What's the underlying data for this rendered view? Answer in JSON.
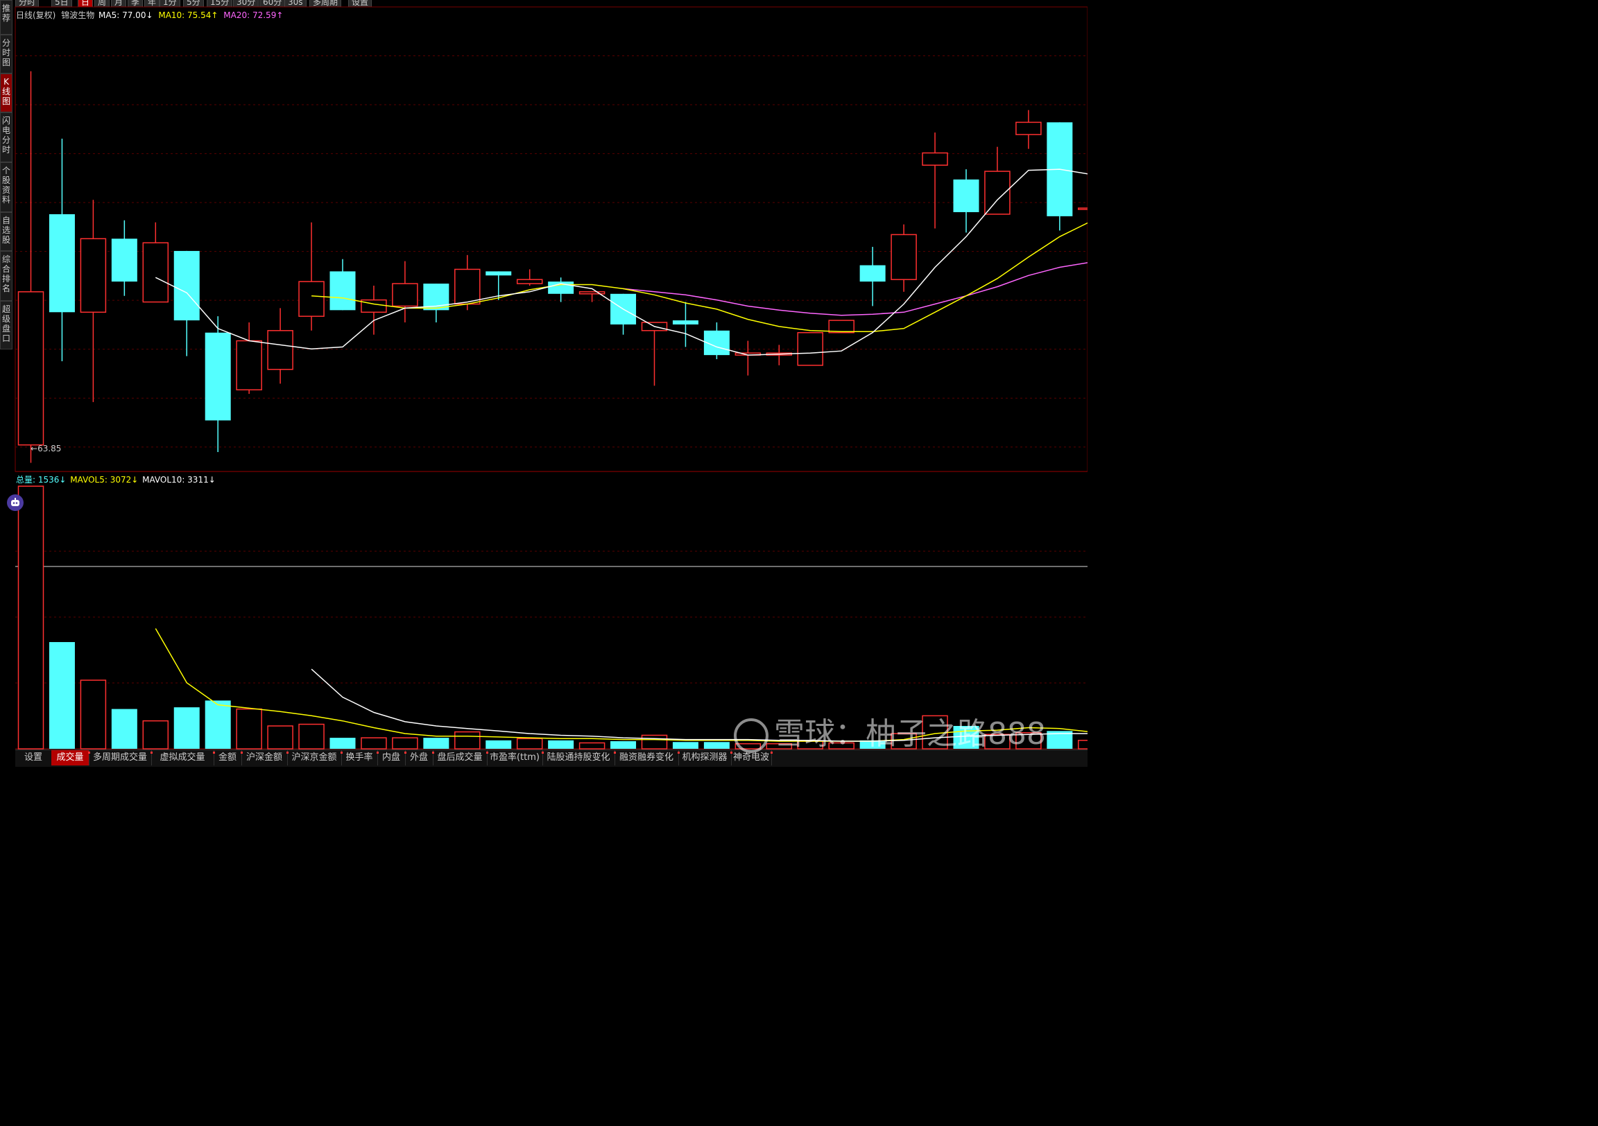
{
  "top_tabs": [
    "分时",
    "5日",
    "日",
    "周",
    "月",
    "季",
    "年",
    "1分",
    "5分",
    "15分",
    "30分",
    "60分",
    "30s",
    "多周期",
    "设置"
  ],
  "top_tabs_active": 2,
  "side_tabs": [
    "推荐",
    "分时图",
    "K线图",
    "闪电分时",
    "个股资料",
    "自选股",
    "综合排名",
    "超级盘口"
  ],
  "side_tabs_active": 2,
  "price_header": {
    "period": "日线(复权)",
    "name": "锦波生物",
    "ma5": "MA5: 77.00↓",
    "ma10": "MA10: 75.54↑",
    "ma20": "MA20: 72.59↑"
  },
  "low_label": "63.85",
  "volume_header": {
    "total": "总量: 1536↓",
    "mavol5": "MAVOL5: 3072↓",
    "mavol10": "MAVOL10: 3311↓"
  },
  "bottom_tabs": [
    "设置",
    "成交量",
    "多周期成交量",
    "虚拟成交量",
    "金额",
    "沪深金额",
    "沪深京金额",
    "换手率",
    "内盘",
    "外盘",
    "盘后成交量",
    "市盈率(ttm)",
    "陆股通持股变化",
    "融资融券变化",
    "机构探测器",
    "神奇电波"
  ],
  "bottom_tabs_active": 1,
  "watermark": "雪球：柚子之路888",
  "colors": {
    "up": "#ff3030",
    "down": "#54ffff",
    "ma5": "#ffffff",
    "ma10": "#ffff00",
    "ma20": "#ff66ff",
    "grid": "#5a0000"
  },
  "chart_data": {
    "type": "candlestick",
    "price_range": [
      63.0,
      108.5
    ],
    "volume_range": [
      0,
      31100
    ],
    "candles": [
      {
        "o": 65.6,
        "c": 80.6,
        "h": 102.2,
        "l": 63.85,
        "vol": 31000
      },
      {
        "o": 88.2,
        "c": 78.6,
        "h": 95.6,
        "l": 73.8,
        "vol": 12600
      },
      {
        "o": 78.6,
        "c": 85.8,
        "h": 89.6,
        "l": 69.8,
        "vol": 8100
      },
      {
        "o": 85.8,
        "c": 81.6,
        "h": 87.6,
        "l": 80.2,
        "vol": 4700
      },
      {
        "o": 79.6,
        "c": 85.4,
        "h": 87.4,
        "l": 79.6,
        "vol": 3300
      },
      {
        "o": 84.6,
        "c": 77.8,
        "h": 84.6,
        "l": 74.3,
        "vol": 4900
      },
      {
        "o": 76.6,
        "c": 68.0,
        "h": 78.2,
        "l": 64.9,
        "vol": 5700
      },
      {
        "o": 71.0,
        "c": 75.8,
        "h": 77.6,
        "l": 70.6,
        "vol": 4700
      },
      {
        "o": 73.0,
        "c": 76.8,
        "h": 79.0,
        "l": 71.6,
        "vol": 2700
      },
      {
        "o": 78.2,
        "c": 81.6,
        "h": 87.4,
        "l": 76.8,
        "vol": 2900
      },
      {
        "o": 82.6,
        "c": 78.8,
        "h": 83.8,
        "l": 78.8,
        "vol": 1300
      },
      {
        "o": 78.6,
        "c": 79.8,
        "h": 81.2,
        "l": 76.4,
        "vol": 1300
      },
      {
        "o": 79.2,
        "c": 81.4,
        "h": 83.6,
        "l": 77.6,
        "vol": 1300
      },
      {
        "o": 81.4,
        "c": 78.8,
        "h": 81.4,
        "l": 77.6,
        "vol": 1300
      },
      {
        "o": 79.4,
        "c": 82.8,
        "h": 84.2,
        "l": 78.8,
        "vol": 2000
      },
      {
        "o": 82.6,
        "c": 82.2,
        "h": 82.6,
        "l": 79.8,
        "vol": 1000
      },
      {
        "o": 81.4,
        "c": 81.8,
        "h": 82.8,
        "l": 81.2,
        "vol": 1200
      },
      {
        "o": 81.6,
        "c": 80.4,
        "h": 82.0,
        "l": 79.6,
        "vol": 1000
      },
      {
        "o": 80.4,
        "c": 80.6,
        "h": 80.6,
        "l": 79.6,
        "vol": 700
      },
      {
        "o": 80.4,
        "c": 77.4,
        "h": 80.4,
        "l": 76.4,
        "vol": 900
      },
      {
        "o": 76.8,
        "c": 77.6,
        "h": 77.6,
        "l": 71.4,
        "vol": 1600
      },
      {
        "o": 77.8,
        "c": 77.4,
        "h": 79.6,
        "l": 75.2,
        "vol": 800
      },
      {
        "o": 76.8,
        "c": 74.4,
        "h": 77.6,
        "l": 74.0,
        "vol": 800
      },
      {
        "o": 74.4,
        "c": 74.6,
        "h": 75.8,
        "l": 72.4,
        "vol": 600
      },
      {
        "o": 74.4,
        "c": 74.6,
        "h": 75.4,
        "l": 73.4,
        "vol": 600
      },
      {
        "o": 73.4,
        "c": 76.6,
        "h": 76.6,
        "l": 73.4,
        "vol": 900
      },
      {
        "o": 76.6,
        "c": 77.8,
        "h": 77.8,
        "l": 76.6,
        "vol": 700
      },
      {
        "o": 83.2,
        "c": 81.6,
        "h": 85.0,
        "l": 79.2,
        "vol": 1000
      },
      {
        "o": 81.8,
        "c": 86.2,
        "h": 87.2,
        "l": 80.6,
        "vol": 1800
      },
      {
        "o": 93.0,
        "c": 94.2,
        "h": 96.2,
        "l": 86.8,
        "vol": 3900
      },
      {
        "o": 91.6,
        "c": 88.4,
        "h": 92.6,
        "l": 86.4,
        "vol": 2700
      },
      {
        "o": 88.2,
        "c": 92.4,
        "h": 94.8,
        "l": 88.2,
        "vol": 1700
      },
      {
        "o": 96.0,
        "c": 97.2,
        "h": 98.4,
        "l": 94.6,
        "vol": 1900
      },
      {
        "o": 97.2,
        "c": 88.0,
        "h": 97.2,
        "l": 86.6,
        "vol": 2100
      },
      {
        "o": 88.8,
        "c": 88.8,
        "h": 88.8,
        "l": 88.8,
        "vol": 1000
      }
    ],
    "ma5": [
      null,
      null,
      null,
      null,
      82.0,
      80.5,
      77.0,
      75.8,
      null,
      75.0,
      75.2,
      77.8,
      79.0,
      79.2,
      79.6,
      80.2,
      80.6,
      81.4,
      80.9,
      78.9,
      77.2,
      76.5,
      75.2,
      74.4,
      74.5,
      74.6,
      74.8,
      76.6,
      79.4,
      83.0,
      86.0,
      89.6,
      92.5,
      92.6,
      92.1
    ],
    "ma10": [
      null,
      null,
      null,
      null,
      null,
      null,
      null,
      null,
      null,
      80.2,
      80.0,
      79.4,
      79.0,
      79.0,
      79.4,
      80.0,
      80.8,
      81.3,
      81.3,
      80.9,
      80.3,
      79.5,
      78.9,
      77.9,
      77.2,
      76.8,
      76.7,
      76.7,
      77.0,
      78.6,
      80.2,
      81.9,
      84.0,
      86.0,
      87.5
    ],
    "ma20": [
      null,
      null,
      null,
      null,
      null,
      null,
      null,
      null,
      null,
      null,
      null,
      null,
      null,
      null,
      null,
      null,
      null,
      null,
      null,
      80.9,
      80.6,
      80.3,
      79.8,
      79.2,
      78.8,
      78.5,
      78.3,
      78.4,
      78.6,
      79.4,
      80.2,
      81.1,
      82.2,
      83.0,
      83.5
    ],
    "mavol5": [
      null,
      null,
      null,
      null,
      14200,
      7800,
      5200,
      4800,
      4400,
      3900,
      3300,
      2500,
      1800,
      1500,
      1500,
      1400,
      1300,
      1200,
      1200,
      1100,
      1100,
      1000,
      1000,
      1000,
      900,
      900,
      900,
      900,
      1100,
      1800,
      2100,
      2200,
      2500,
      2400,
      2000
    ],
    "mavol10": [
      null,
      null,
      null,
      null,
      null,
      null,
      null,
      null,
      null,
      9400,
      6100,
      4300,
      3200,
      2700,
      2400,
      2100,
      1800,
      1600,
      1500,
      1300,
      1200,
      1100,
      1100,
      1100,
      1000,
      1000,
      900,
      900,
      1000,
      1300,
      1500,
      1600,
      1700,
      1800,
      1800
    ]
  }
}
